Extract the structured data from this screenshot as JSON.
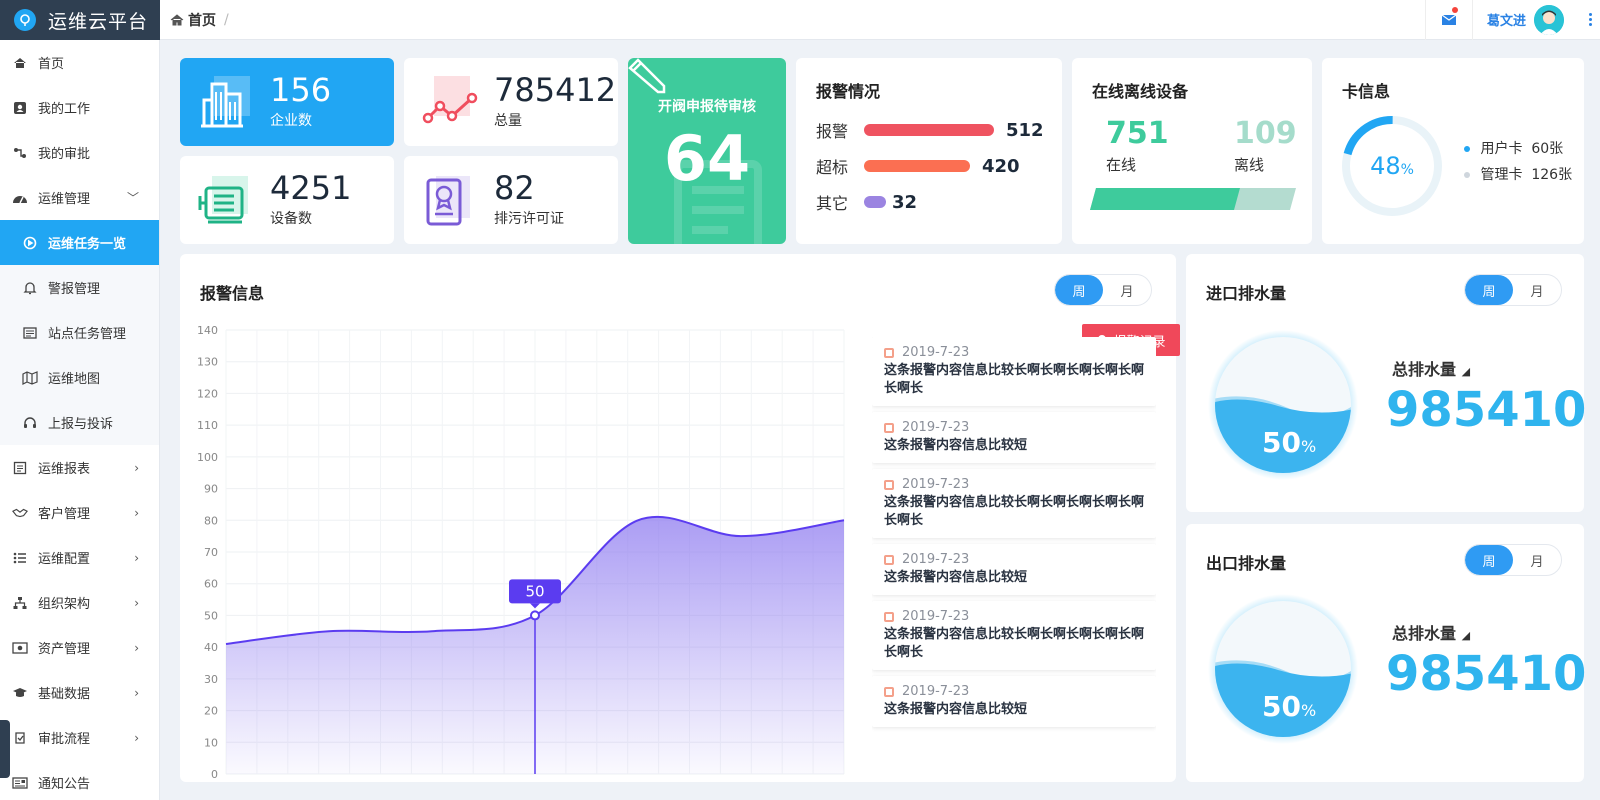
{
  "app": {
    "title": "运维云平台"
  },
  "breadcrumb": {
    "home": "首页",
    "sep": "/"
  },
  "user": {
    "name": "葛文进"
  },
  "sidebar": {
    "items": [
      {
        "label": "首页",
        "icon": "home-icon"
      },
      {
        "label": "我的工作",
        "icon": "user-card-icon"
      },
      {
        "label": "我的审批",
        "icon": "flow-icon"
      },
      {
        "label": "运维管理",
        "icon": "dashboard-icon",
        "arrow": "﹀"
      },
      {
        "label": "运维任务一览",
        "icon": "play-circle-icon",
        "active": true
      },
      {
        "label": "警报管理",
        "icon": "bell-icon"
      },
      {
        "label": "站点任务管理",
        "icon": "list-card-icon"
      },
      {
        "label": "运维地图",
        "icon": "map-icon"
      },
      {
        "label": "上报与投诉",
        "icon": "headset-icon"
      },
      {
        "label": "运维报表",
        "icon": "report-icon",
        "arrow": "›"
      },
      {
        "label": "客户管理",
        "icon": "handshake-icon",
        "arrow": "›"
      },
      {
        "label": "运维配置",
        "icon": "config-list-icon",
        "arrow": "›"
      },
      {
        "label": "组织架构",
        "icon": "org-icon",
        "arrow": "›"
      },
      {
        "label": "资产管理",
        "icon": "asset-icon",
        "arrow": "›"
      },
      {
        "label": "基础数据",
        "icon": "mortarboard-icon",
        "arrow": "›"
      },
      {
        "label": "审批流程",
        "icon": "approval-icon",
        "arrow": "›"
      },
      {
        "label": "通知公告",
        "icon": "notice-icon"
      }
    ]
  },
  "stats": {
    "enterprise": {
      "value": "156",
      "label": "企业数"
    },
    "total": {
      "value": "785412",
      "label": "总量"
    },
    "devices": {
      "value": "4251",
      "label": "设备数"
    },
    "permits": {
      "value": "82",
      "label": "排污许可证"
    }
  },
  "pending": {
    "title": "开阀申报待审核",
    "value": "64"
  },
  "alarm_status": {
    "title": "报警情况",
    "rows": [
      {
        "label": "报警",
        "value": "512",
        "color": "#ef5360"
      },
      {
        "label": "超标",
        "value": "420",
        "color": "#fb6f52"
      },
      {
        "label": "其它",
        "value": "32",
        "color": "#9b84e1"
      }
    ]
  },
  "online": {
    "title": "在线离线设备",
    "online_value": "751",
    "online_label": "在线",
    "offline_value": "109",
    "offline_label": "离线",
    "online_fraction": 0.72
  },
  "cards": {
    "title": "卡信息",
    "percent": "48",
    "percent_unit": "%",
    "user_card": "用户卡",
    "user_count": "60张",
    "admin_card": "管理卡",
    "admin_count": "126张"
  },
  "alarm_info": {
    "title": "报警信息",
    "tabs": [
      "周",
      "月"
    ],
    "tag": "报警记录",
    "tooltip": "50",
    "list": [
      {
        "date": "2019-7-23",
        "text": "这条报警内容信息比较长啊长啊长啊长啊长啊长啊长"
      },
      {
        "date": "2019-7-23",
        "text": "这条报警内容信息比较短"
      },
      {
        "date": "2019-7-23",
        "text": "这条报警内容信息比较长啊长啊长啊长啊长啊长啊长"
      },
      {
        "date": "2019-7-23",
        "text": "这条报警内容信息比较短"
      },
      {
        "date": "2019-7-23",
        "text": "这条报警内容信息比较长啊长啊长啊长啊长啊长啊长"
      },
      {
        "date": "2019-7-23",
        "text": "这条报警内容信息比较短"
      }
    ]
  },
  "chart_data": {
    "type": "area",
    "x": [
      1,
      2,
      3,
      4,
      5,
      6,
      7
    ],
    "y": [
      41,
      45,
      45,
      50,
      80,
      75,
      80
    ],
    "xlim": [
      1,
      7
    ],
    "ylim": [
      0,
      140
    ],
    "yticks": [
      0,
      10,
      20,
      30,
      40,
      50,
      60,
      70,
      80,
      90,
      100,
      110,
      120,
      130,
      140
    ],
    "xticks": [
      "1",
      "2",
      "3",
      "4",
      "5",
      "6",
      "7"
    ],
    "highlight_x": 4,
    "grid": true,
    "color": "#5b3cf0"
  },
  "inlet": {
    "title": "进口排水量",
    "tabs": [
      "周",
      "月"
    ],
    "label": "总排水量",
    "value": "985410",
    "percent": "50",
    "percent_unit": "%"
  },
  "outlet": {
    "title": "出口排水量",
    "tabs": [
      "周",
      "月"
    ],
    "label": "总排水量",
    "value": "985410",
    "percent": "50",
    "percent_unit": "%"
  }
}
